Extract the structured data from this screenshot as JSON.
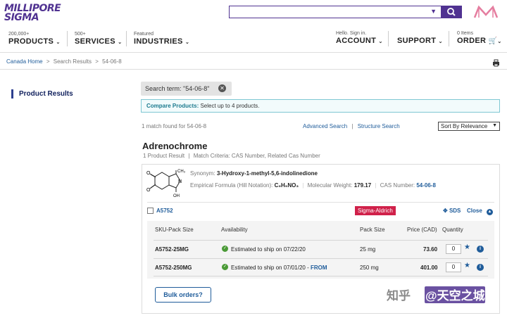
{
  "brand": {
    "line1": "MILLIPORE",
    "line2": "SIGMA",
    "accent": "#503291"
  },
  "search": {
    "value": "",
    "placeholder": ""
  },
  "nav": {
    "products": {
      "small": "200,000+",
      "label": "PRODUCTS"
    },
    "services": {
      "small": "500+",
      "label": "SERVICES"
    },
    "industries": {
      "small": "Featured",
      "label": "INDUSTRIES"
    },
    "account": {
      "small": "Hello. Sign in.",
      "label": "ACCOUNT"
    },
    "support": {
      "label": "SUPPORT"
    },
    "order": {
      "small": "0 Items",
      "label": "ORDER"
    }
  },
  "breadcrumb": {
    "home": "Canada Home",
    "sep": ">",
    "results": "Search Results",
    "current": "54-06-8"
  },
  "sidebar": {
    "title": "Product Results"
  },
  "search_chip": {
    "text": "Search term: \"54-06-8\""
  },
  "compare": {
    "label": "Compare Products:",
    "text": "Select up to 4 products."
  },
  "results": {
    "count_text": "1 match found for 54-06-8",
    "advanced": "Advanced Search",
    "sep": "|",
    "structure": "Structure Search",
    "sort": "Sort By Relevance"
  },
  "product_group": {
    "title": "Adrenochrome",
    "meta_count": "1 Product Result",
    "meta_sep": "|",
    "meta_match": "Match Criteria: CAS Number, Related Cas Number"
  },
  "product": {
    "synonym_label": "Synonym:",
    "synonym": "3-Hydroxy-1-methyl-5,6-indolinedione",
    "formula_label": "Empirical Formula (Hill Notation):",
    "formula": "C₉H₉NO₃",
    "mw_label": "Molecular Weight:",
    "mw": "179.17",
    "cas_label": "CAS Number:",
    "cas": "54-06-8",
    "id": "A5752",
    "brand": "Sigma-Aldrich",
    "sds": "SDS",
    "close": "Close",
    "struct": {
      "ch3": "CH₃",
      "n": "N",
      "oh": "OH",
      "o1": "O",
      "o2": "O"
    }
  },
  "table": {
    "headers": {
      "sku": "SKU-Pack Size",
      "availability": "Availability",
      "pack": "Pack Size",
      "price": "Price (CAD)",
      "qty": "Quantity"
    },
    "rows": [
      {
        "sku": "A5752-25MG",
        "availability": "Estimated to ship on 07/22/20",
        "from": "",
        "pack": "25 mg",
        "price": "73.60",
        "qty": "0"
      },
      {
        "sku": "A5752-250MG",
        "availability": "Estimated to ship on 07/01/20 -",
        "from": "FROM",
        "pack": "250 mg",
        "price": "401.00",
        "qty": "0"
      }
    ]
  },
  "bulk": "Bulk orders?",
  "watermark": {
    "left": "知乎",
    "right": "@天空之城"
  }
}
